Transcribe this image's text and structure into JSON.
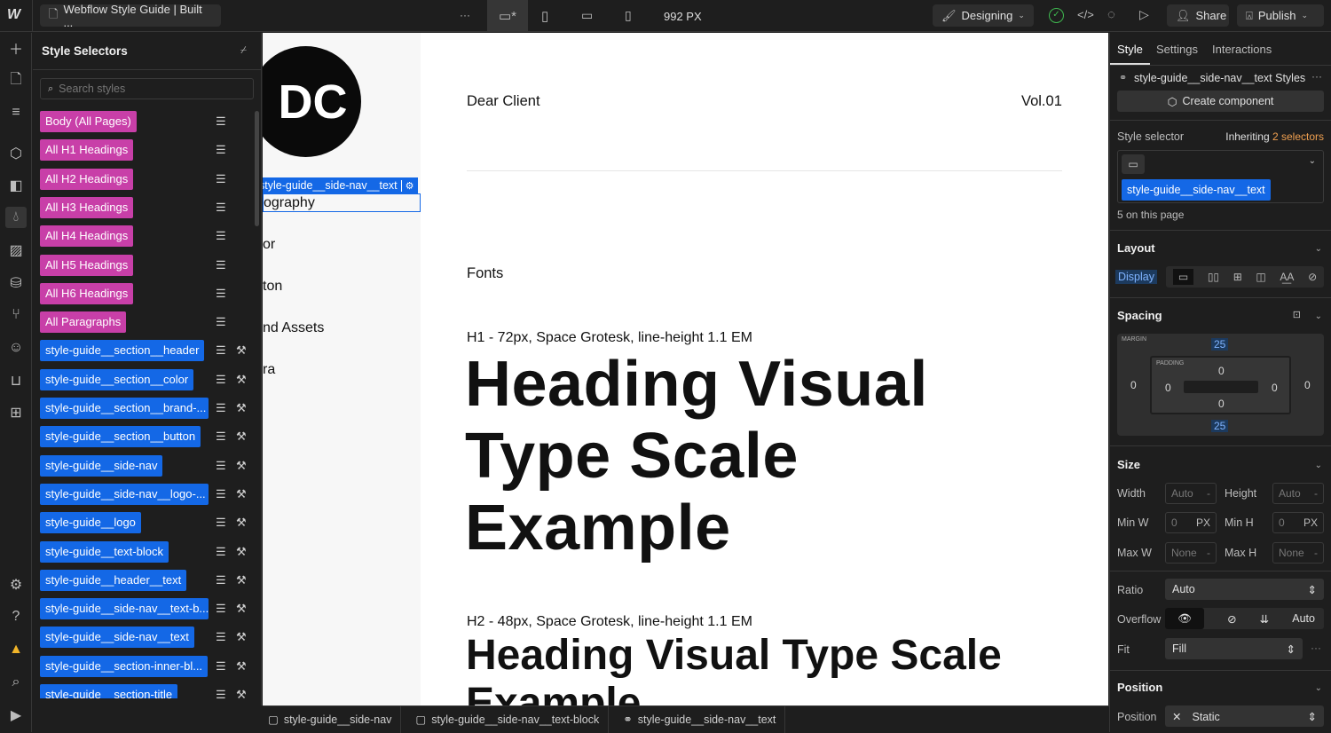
{
  "topbar": {
    "logo": "W",
    "page_title": "Webflow Style Guide | Built ...",
    "more": "···",
    "breakpoint_width": "992 PX",
    "mode": "Designing",
    "share": "Share",
    "publish": "Publish"
  },
  "style_selectors": {
    "title": "Style Selectors",
    "search_placeholder": "Search styles",
    "items": [
      {
        "label": "Body (All Pages)",
        "type": "tag"
      },
      {
        "label": "All H1 Headings",
        "type": "tag"
      },
      {
        "label": "All H2 Headings",
        "type": "tag"
      },
      {
        "label": "All H3 Headings",
        "type": "tag"
      },
      {
        "label": "All H4 Headings",
        "type": "tag"
      },
      {
        "label": "All H5 Headings",
        "type": "tag"
      },
      {
        "label": "All H6 Headings",
        "type": "tag"
      },
      {
        "label": "All Paragraphs",
        "type": "tag"
      },
      {
        "label": "style-guide__section__header",
        "type": "class"
      },
      {
        "label": "style-guide__section__color",
        "type": "class"
      },
      {
        "label": "style-guide__section__brand-...",
        "type": "class"
      },
      {
        "label": "style-guide__section__button",
        "type": "class"
      },
      {
        "label": "style-guide__side-nav",
        "type": "class"
      },
      {
        "label": "style-guide__side-nav__logo-...",
        "type": "class"
      },
      {
        "label": "style-guide__logo",
        "type": "class"
      },
      {
        "label": "style-guide__text-block",
        "type": "class"
      },
      {
        "label": "style-guide__header__text",
        "type": "class"
      },
      {
        "label": "style-guide__side-nav__text-b...",
        "type": "class"
      },
      {
        "label": "style-guide__side-nav__text",
        "type": "class"
      },
      {
        "label": "style-guide__section-inner-bl...",
        "type": "class"
      },
      {
        "label": "style-guide__section-title",
        "type": "class"
      }
    ],
    "colors": {
      "tag": "#c83fa8",
      "class": "#1468e6"
    }
  },
  "canvas": {
    "logo_text": "DC",
    "selected_label": "style-guide__side-nav__text",
    "nav_items": [
      "ography",
      "or",
      "ton",
      "nd Assets",
      "ra"
    ],
    "header_left": "Dear Client",
    "header_right": "Vol.01",
    "section": "Fonts",
    "h1_caption": "H1 - 72px, Space Grotesk, line-height 1.1 EM",
    "h1_text": "Heading Visual Type Scale Example",
    "h2_caption": "H2 - 48px, Space Grotesk, line-height 1.1 EM",
    "h2_text": "Heading Visual Type Scale Example"
  },
  "breadcrumbs": [
    "style-guide__side-nav",
    "style-guide__side-nav__text-block",
    "style-guide__side-nav__text"
  ],
  "right_panel": {
    "tabs": [
      "Style",
      "Settings",
      "Interactions"
    ],
    "styles_title": "style-guide__side-nav__text Styles",
    "create_component": "Create component",
    "style_selector_label": "Style selector",
    "inheriting_prefix": "Inheriting",
    "inheriting_link": "2 selectors",
    "selector_chip": "style-guide__side-nav__text",
    "on_page": "5 on this page",
    "layout": {
      "title": "Layout",
      "display_label": "Display"
    },
    "spacing": {
      "title": "Spacing",
      "margin_label": "MARGIN",
      "padding_label": "PADDING",
      "margin": {
        "top": "25",
        "right": "0",
        "bottom": "25",
        "left": "0"
      },
      "padding": {
        "top": "0",
        "right": "0",
        "bottom": "0",
        "left": "0"
      }
    },
    "size": {
      "title": "Size",
      "width_label": "Width",
      "width": "Auto",
      "height_label": "Height",
      "height": "Auto",
      "minw_label": "Min W",
      "minw": "0",
      "minh_label": "Min H",
      "minh": "0",
      "unit_px": "PX",
      "unit_dash": "-",
      "maxw_label": "Max W",
      "maxw": "None",
      "maxh_label": "Max H",
      "maxh": "None",
      "ratio_label": "Ratio",
      "ratio": "Auto",
      "overflow_label": "Overflow",
      "overflow_auto": "Auto",
      "fit_label": "Fit",
      "fit": "Fill"
    },
    "position": {
      "title": "Position",
      "label": "Position",
      "value": "Static"
    },
    "accent": "#1468e6"
  }
}
